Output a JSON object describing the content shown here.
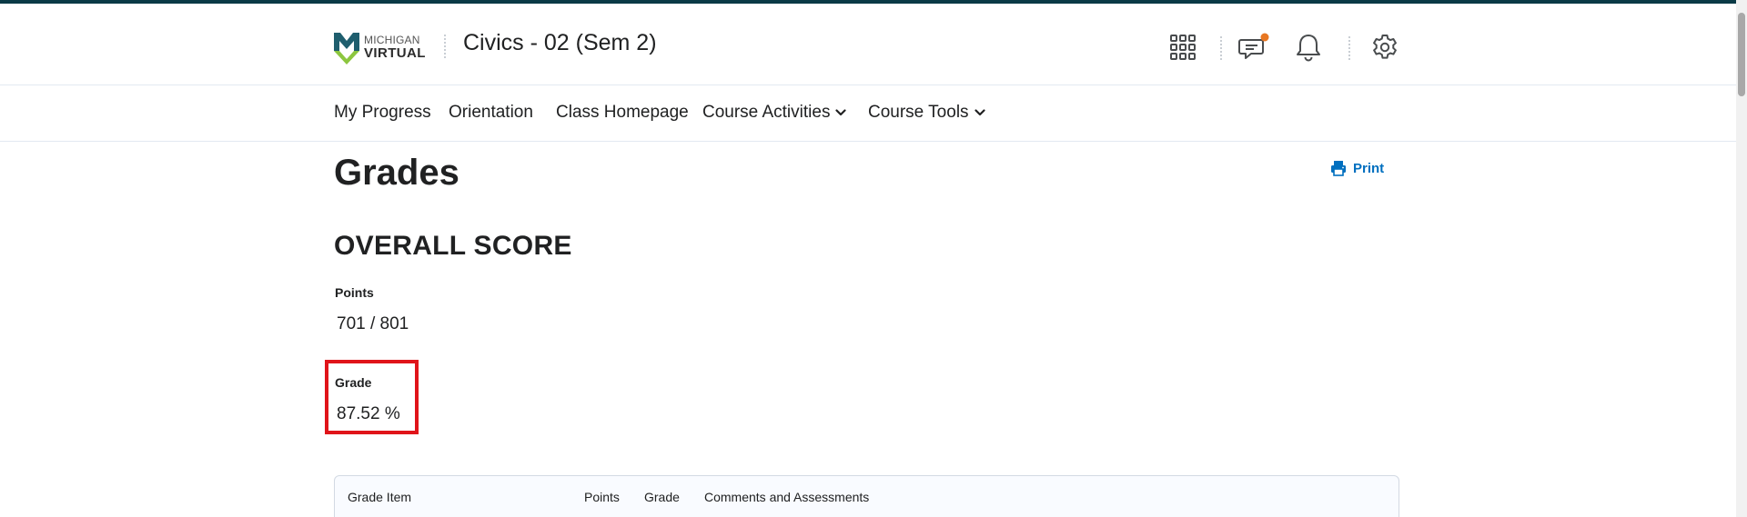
{
  "header": {
    "logo": {
      "line1": "MICHIGAN",
      "line2": "VIRTUAL",
      "colors": {
        "green": "#8cc63f",
        "teal": "#1f5e6e"
      }
    },
    "course_title": "Civics - 02 (Sem 2)",
    "icons": [
      "grid-icon",
      "chat-icon",
      "bell-icon",
      "gear-icon"
    ],
    "notification_dot_color": "#e87722"
  },
  "nav": {
    "items": [
      {
        "label": "My Progress",
        "dropdown": false
      },
      {
        "label": "Orientation",
        "dropdown": false
      },
      {
        "label": "Class Homepage",
        "dropdown": false
      },
      {
        "label": "Course Activities",
        "dropdown": true
      },
      {
        "label": "Course Tools",
        "dropdown": true
      }
    ]
  },
  "page": {
    "title": "Grades",
    "print_label": "Print",
    "link_color": "#006fbf"
  },
  "overall": {
    "section_title": "OVERALL SCORE",
    "points_label": "Points",
    "points_value": "701 / 801",
    "grade_label": "Grade",
    "grade_value": "87.52 %",
    "highlight_color": "#e0141a"
  },
  "table": {
    "columns": [
      "Grade Item",
      "Points",
      "Grade",
      "Comments and Assessments"
    ]
  }
}
